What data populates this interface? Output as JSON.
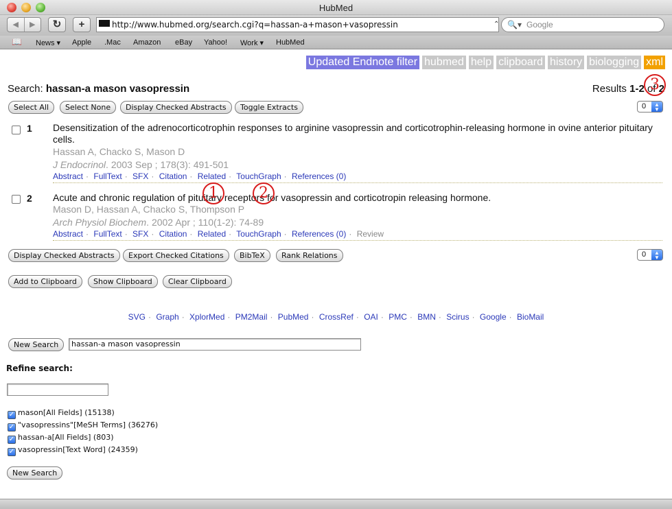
{
  "window": {
    "title": "HubMed"
  },
  "toolbar": {
    "back_symbol": "◀",
    "forward_symbol": "▶",
    "reload_symbol": "↻",
    "add_symbol": "+",
    "url": "http://www.hubmed.org/search.cgi?q=hassan-a+mason+vasopressin",
    "search_placeholder": "Google"
  },
  "bookmarks": [
    "News ▾",
    "Apple",
    ".Mac",
    "Amazon",
    "eBay",
    "Yahoo!",
    "Work ▾",
    "HubMed"
  ],
  "topnav": [
    "Updated Endnote filter",
    "hubmed",
    "help",
    "clipboard",
    "history",
    "biologging",
    "xml"
  ],
  "search": {
    "label": "Search:",
    "query": "hassan-a mason vasopressin"
  },
  "results_count": {
    "prefix": "Results",
    "range": "1-2",
    "of_word": "of",
    "total": "2"
  },
  "top_buttons": [
    "Select All",
    "Select None",
    "Display Checked Abstracts",
    "Toggle Extracts"
  ],
  "select_value": "0",
  "results": [
    {
      "num": "1",
      "title": "Desensitization of the adrenocorticotrophin responses to arginine vasopressin and corticotrophin-releasing hormone in ovine anterior pituitary cells.",
      "authors": "Hassan A, Chacko S, Mason D",
      "journal": "J Endocrinol",
      "citation": ". 2003 Sep ; 178(3): 491-501",
      "links": [
        "Abstract",
        "FullText",
        "SFX",
        "Citation",
        "Related",
        "TouchGraph",
        "References (0)"
      ],
      "review": ""
    },
    {
      "num": "2",
      "title": "Acute and chronic regulation of pituitary receptors for vasopressin and corticotropin releasing hormone.",
      "authors": "Mason D, Hassan A, Chacko S, Thompson P",
      "journal": "Arch Physiol Biochem",
      "citation": ". 2002 Apr ; 110(1-2): 74-89",
      "links": [
        "Abstract",
        "FullText",
        "SFX",
        "Citation",
        "Related",
        "TouchGraph",
        "References (0)"
      ],
      "review": "Review"
    }
  ],
  "annotations": [
    "1",
    "2",
    "3"
  ],
  "bottom_buttons": [
    "Display Checked Abstracts",
    "Export Checked Citations",
    "BibTeX",
    "Rank Relations"
  ],
  "clipboard_buttons": [
    "Add to Clipboard",
    "Show Clipboard",
    "Clear Clipboard"
  ],
  "footer_links": [
    "SVG",
    "Graph",
    "XplorMed",
    "PM2Mail",
    "PubMed",
    "CrossRef",
    "OAI",
    "PMC",
    "BMN",
    "Scirus",
    "Google",
    "BioMail"
  ],
  "new_search": {
    "button": "New Search",
    "value": "hassan-a mason vasopressin"
  },
  "refine": {
    "label": "Refine search:",
    "input_value": "",
    "facets": [
      "mason[All Fields] (15138)",
      "\"vasopressins\"[MeSH Terms] (36276)",
      "hassan-a[All Fields] (803)",
      "vasopressin[Text Word] (24359)"
    ],
    "button": "New Search"
  }
}
